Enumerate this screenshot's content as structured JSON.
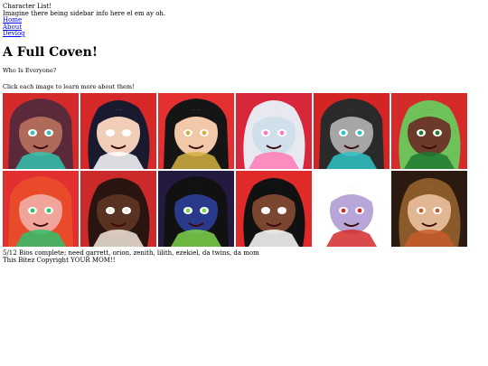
{
  "sidebar": {
    "title": "Character List!",
    "info": "Imagine there being sidebar info here el em ay oh.",
    "links": [
      "Home",
      "About",
      "Devlog"
    ]
  },
  "main": {
    "heading": "A Full Coven!",
    "question": "Who Is Everyone?",
    "instruction": "Click each image to learn more about them!"
  },
  "gallery": {
    "tiles": [
      {
        "bg": "#d42a2a",
        "skin": "#b06a5a",
        "hair": "#5a2a3a",
        "accent": "#33c4b0"
      },
      {
        "bg": "#d62828",
        "skin": "#f2cdb8",
        "hair": "#1a1a2e",
        "accent": "#ffffff"
      },
      {
        "bg": "#e43030",
        "skin": "#f2c8a8",
        "hair": "#151515",
        "accent": "#d4b040"
      },
      {
        "bg": "#d8263a",
        "skin": "#cfe0ea",
        "hair": "#e8e8f0",
        "accent": "#ff7ab6"
      },
      {
        "bg": "#d42424",
        "skin": "#a6a6a6",
        "hair": "#2a2a2a",
        "accent": "#2ec4c4"
      },
      {
        "bg": "#d42a2a",
        "skin": "#6b3a2a",
        "hair": "#6fc25a",
        "accent": "#1f7a30"
      },
      {
        "bg": "#e23030",
        "skin": "#f0a49a",
        "hair": "#e84a2a",
        "accent": "#2fbf6a"
      },
      {
        "bg": "#cc2a2a",
        "skin": "#5a3222",
        "hair": "#2a1410",
        "accent": "#f2e8d8"
      },
      {
        "bg": "#241a40",
        "skin": "#2a3a8a",
        "hair": "#111111",
        "accent": "#7ed44a"
      },
      {
        "bg": "#e02a2a",
        "skin": "#7a4630",
        "hair": "#111111",
        "accent": "#ffffff"
      },
      {
        "bg": "#ffffff",
        "skin": "#b8a6d8",
        "hair": "#ffffff",
        "accent": "#d42a2a"
      },
      {
        "bg": "#2a1a10",
        "skin": "#e2b894",
        "hair": "#8a5a2a",
        "accent": "#c85a2a"
      }
    ]
  },
  "footer": {
    "status": "5/12 Bios complete; need garrett, orion, zenith, lilith, ezekiel, da twins, da mom",
    "copyright": "This Bitez Copyright YOUR MOM!!"
  }
}
